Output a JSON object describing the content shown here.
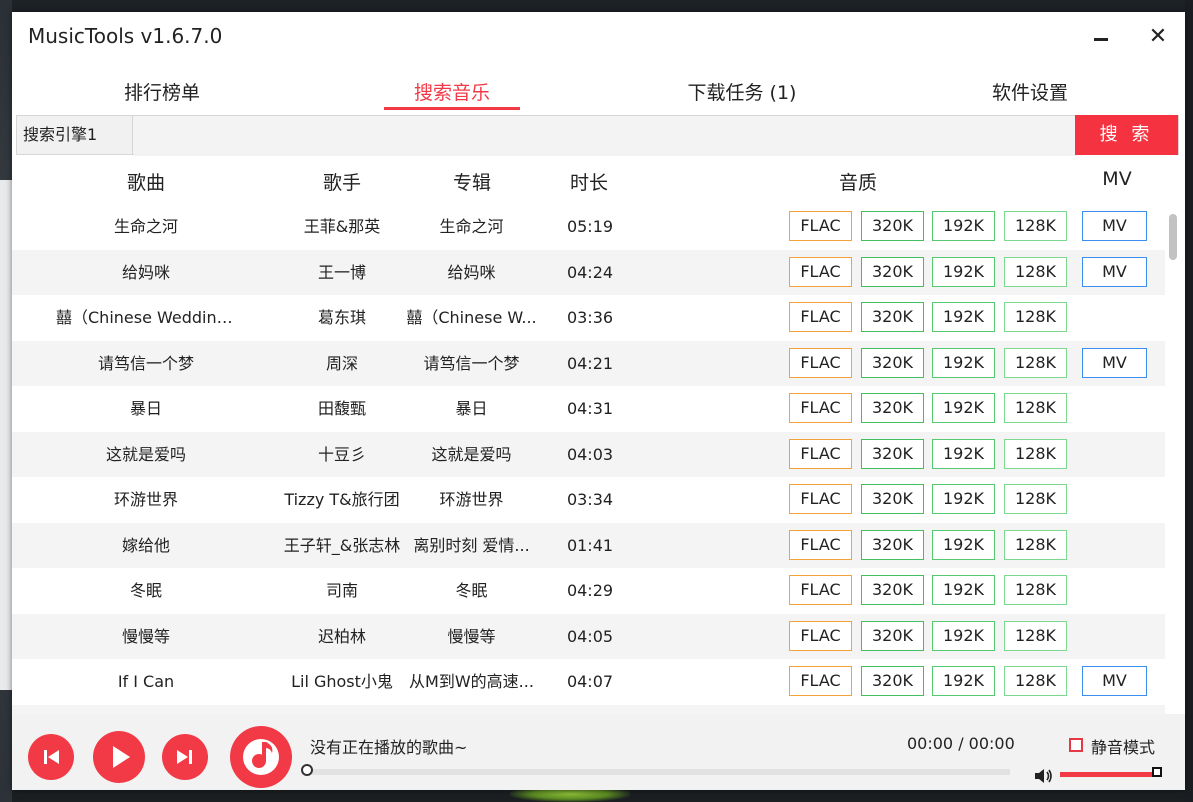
{
  "window": {
    "title": "MusicTools v1.6.7.0",
    "minimize_label": "",
    "close_label": "✕"
  },
  "tabs": [
    {
      "label": "排行榜单"
    },
    {
      "label": "搜索音乐"
    },
    {
      "label": "下载任务 (1)"
    },
    {
      "label": "软件设置"
    }
  ],
  "active_tab": "搜索音乐",
  "search": {
    "engine": "搜索引擎1",
    "query": "",
    "button_label": "搜 索"
  },
  "columns": {
    "song": "歌曲",
    "artist": "歌手",
    "album": "专辑",
    "duration": "时长",
    "quality": "音质",
    "mv": "MV"
  },
  "quality_labels": {
    "flac": "FLAC",
    "q320": "320K",
    "q192": "192K",
    "q128": "128K",
    "mv": "MV"
  },
  "songs": [
    {
      "title": "生命之河",
      "artist": "王菲&那英",
      "album": "生命之河",
      "duration": "05:19",
      "mv": true
    },
    {
      "title": "给妈咪",
      "artist": "王一博",
      "album": "给妈咪",
      "duration": "04:24",
      "mv": true
    },
    {
      "title": "囍（Chinese Wedding）",
      "artist": "葛东琪",
      "album": "囍（Chinese W...",
      "duration": "03:36",
      "mv": false
    },
    {
      "title": "请笃信一个梦",
      "artist": "周深",
      "album": "请笃信一个梦",
      "duration": "04:21",
      "mv": true
    },
    {
      "title": "暴日",
      "artist": "田馥甄",
      "album": "暴日",
      "duration": "04:31",
      "mv": false
    },
    {
      "title": "这就是爱吗",
      "artist": "十豆彡",
      "album": "这就是爱吗",
      "duration": "04:03",
      "mv": false
    },
    {
      "title": "环游世界",
      "artist": "Tizzy T&旅行团",
      "album": "环游世界",
      "duration": "03:34",
      "mv": false
    },
    {
      "title": "嫁给他",
      "artist": "王子轩_&张志林",
      "album": "离别时刻 爱情...",
      "duration": "01:41",
      "mv": false
    },
    {
      "title": "冬眠",
      "artist": "司南",
      "album": "冬眠",
      "duration": "04:29",
      "mv": false
    },
    {
      "title": "慢慢等",
      "artist": "迟柏林",
      "album": "慢慢等",
      "duration": "04:05",
      "mv": false
    },
    {
      "title": "If I Can",
      "artist": "Lil Ghost小鬼",
      "album": "从M到W的高速...",
      "duration": "04:07",
      "mv": true
    }
  ],
  "player": {
    "now_playing": "没有正在播放的歌曲~",
    "time": "00:00 / 00:00",
    "mute_label": "静音模式",
    "mute_checked": false,
    "progress": 0,
    "volume": 1.0
  },
  "colors": {
    "accent": "#f23a46",
    "flac": "#f2a23a",
    "kbps": "#3fbf5f",
    "mv": "#3b8ef0"
  }
}
